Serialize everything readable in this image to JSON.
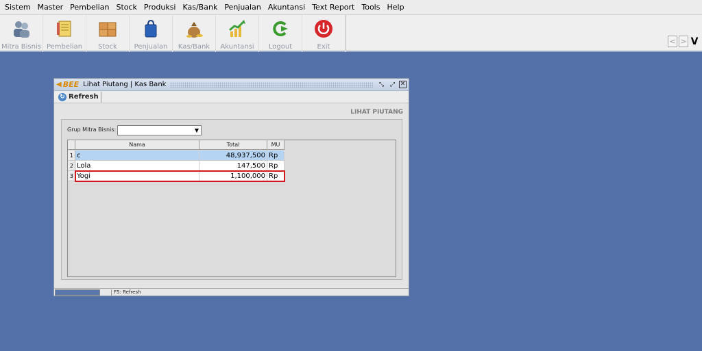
{
  "menu": [
    "Sistem",
    "Master",
    "Pembelian",
    "Stock",
    "Produksi",
    "Kas/Bank",
    "Penjualan",
    "Akuntansi",
    "Text Report",
    "Tools",
    "Help"
  ],
  "toolbar": [
    {
      "label": "Mitra Bisnis",
      "icon": "users-icon",
      "color": "#6f87a6"
    },
    {
      "label": "Pembelian",
      "icon": "notebook-icon",
      "color": "#d4a94a"
    },
    {
      "label": "Stock",
      "icon": "boxes-icon",
      "color": "#cf8a43"
    },
    {
      "label": "Penjualan",
      "icon": "shopping-bag-icon",
      "color": "#2a62b8"
    },
    {
      "label": "Kas/Bank",
      "icon": "money-bag-icon",
      "color": "#b07a3b"
    },
    {
      "label": "Akuntansi",
      "icon": "growth-chart-icon",
      "color": "#3da13d"
    },
    {
      "label": "Logout",
      "icon": "logout-icon",
      "color": "#3a9b2f"
    },
    {
      "label": "Exit",
      "icon": "power-icon",
      "color": "#d7262a"
    }
  ],
  "nav": {
    "prev": "<",
    "next": ">",
    "v": "V"
  },
  "window": {
    "brand": "BEE",
    "title": "Lihat Piutang | Kas Bank",
    "refresh_label": "Refresh",
    "section_title": "LIHAT PIUTANG",
    "filter_label": "Grup Mitra Bisnis:",
    "filter_value": "",
    "columns": [
      "Nama",
      "Total",
      "MU"
    ],
    "rows": [
      {
        "num": "1",
        "nama": "c",
        "total": "48,937,500",
        "mu": "Rp"
      },
      {
        "num": "2",
        "nama": "Lola",
        "total": "147,500",
        "mu": "Rp"
      },
      {
        "num": "3",
        "nama": "Yogi",
        "total": "1,100,000",
        "mu": "Rp"
      }
    ],
    "status_text": "F5: Refresh"
  }
}
